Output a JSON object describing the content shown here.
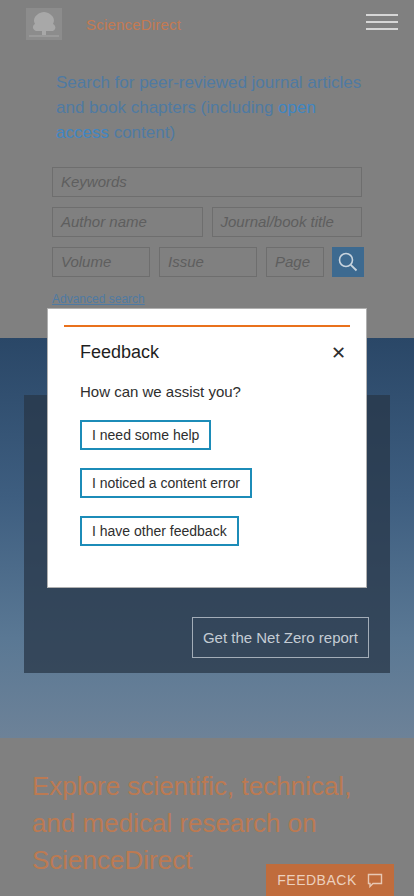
{
  "header": {
    "logo_text": "ScienceDirect"
  },
  "search": {
    "intro_before": "Search for peer-reviewed journal articles and book chapters (including ",
    "intro_link": "open access",
    "intro_after": " content)",
    "fields": [
      {
        "placeholder": "Keywords"
      },
      {
        "placeholder": "Author name"
      },
      {
        "placeholder": "Journal/book title"
      },
      {
        "placeholder": "Volume"
      },
      {
        "placeholder": "Issue"
      },
      {
        "placeholder": "Page"
      }
    ],
    "advanced_link": "Advanced search"
  },
  "promo": {
    "button": "Get the Net Zero report"
  },
  "headline": "Explore scientific, technical, and medical research on ScienceDirect",
  "feedback_tab": {
    "label": "FEEDBACK"
  },
  "dialog": {
    "title": "Feedback",
    "close": "✕",
    "question": "How can we assist you?",
    "options": [
      "I need some help",
      "I noticed a content error",
      "I have other feedback"
    ]
  }
}
